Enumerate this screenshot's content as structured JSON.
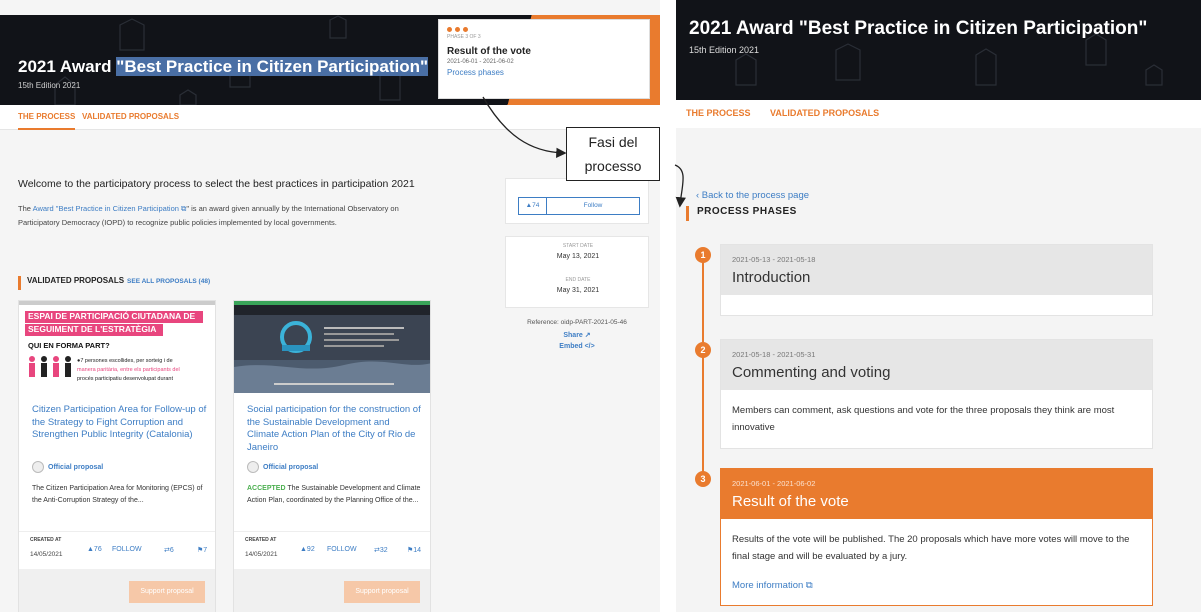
{
  "left": {
    "hero": {
      "title_pre": "2021 Award ",
      "title_highlight": "\"Best Practice in Citizen Participation\"",
      "subtitle": "15th Edition 2021"
    },
    "phase_card": {
      "phase_of": "PHASE 3 OF 3",
      "name": "Result of the vote",
      "dates": "2021-06-01 - 2021-06-02",
      "link": "Process phases"
    },
    "tabs": [
      "THE PROCESS",
      "VALIDATED PROPOSALS"
    ],
    "welcome": "Welcome to the participatory process to select the best practices in participation 2021",
    "desc": {
      "pre": "The ",
      "link": "Award \"Best Practice in Citizen Participation ⧉",
      "post": "\" is an award given annually by the International Observatory on Participatory Democracy (IOPD) to recognize public policies implemented by local governments."
    },
    "validated": {
      "heading": "VALIDATED PROPOSALS",
      "see_all": "SEE ALL PROPOSALS (48)"
    },
    "proposals": [
      {
        "image_text": {
          "line1": "ESPAI DE PARTICIPACIÓ CIUTADANA DE",
          "line2": "SEGUIMENT DE L'ESTRATÈGIA",
          "line3": "QUI EN FORMA PART?",
          "b1": "●7 persones escollides, per sorteig i de",
          "b2": "manera paritària, entre els participants del",
          "b3": "procés participatiu desenvolupat durant"
        },
        "title": "Citizen Participation Area for Follow-up of the Strategy to Fight Corruption and Strengthen Public Integrity (Catalonia)",
        "official": "Official proposal",
        "accepted": "",
        "desc": "The Citizen Participation Area for Monitoring (EPCS) of the Anti-Corruption Strategy of the...",
        "created_label": "CREATED AT",
        "created_date": "14/05/2021",
        "supports": "▲76",
        "follow": "FOLLOW",
        "comments": "⇄6",
        "flags": "⚑7",
        "suggest": "Support proposal"
      },
      {
        "title": "Social participation for the construction of the Sustainable Development and Climate Action Plan of the City of Rio de Janeiro",
        "official": "Official proposal",
        "accepted": "ACCEPTED",
        "desc": " The Sustainable Development and Climate Action Plan, coordinated by the Planning Office of the...",
        "created_label": "CREATED AT",
        "created_date": "14/05/2021",
        "supports": "▲92",
        "follow": "FOLLOW",
        "comments": "⇄32",
        "flags": "⚑14",
        "suggest": "Support proposal"
      }
    ],
    "sidebar": {
      "follow_count": "▲74",
      "follow_label": "Follow",
      "start_label": "START DATE",
      "start_date": "May 13, 2021",
      "end_label": "END DATE",
      "end_date": "May 31, 2021",
      "reference": "Reference: oidp-PART-2021-05-46",
      "share": "Share ↗",
      "embed": "Embed </>"
    }
  },
  "callout": {
    "line1": "Fasi del",
    "line2": "processo"
  },
  "right": {
    "hero": {
      "title": "2021 Award \"Best Practice in Citizen Participation\"",
      "subtitle": "15th Edition 2021"
    },
    "tabs": [
      "THE PROCESS",
      "VALIDATED PROPOSALS"
    ],
    "back": "‹ Back to the process page",
    "heading": "PROCESS PHASES",
    "phases": [
      {
        "num": "1",
        "dates": "2021-05-13 - 2021-05-18",
        "name": "Introduction",
        "body": ""
      },
      {
        "num": "2",
        "dates": "2021-05-18 - 2021-05-31",
        "name": "Commenting and voting",
        "body": "Members can comment, ask questions and vote for the three proposals they think are most innovative"
      },
      {
        "num": "3",
        "dates": "2021-06-01 - 2021-06-02",
        "name": "Result of the vote",
        "body": "Results of the vote will be published. The 20 proposals which have more votes will move to the final stage and will be evaluated by a jury.",
        "more": "More information ⧉"
      }
    ]
  },
  "colors": {
    "accent": "#e97b2e",
    "link": "#3d7dc4",
    "hero_bg": "#111318"
  }
}
